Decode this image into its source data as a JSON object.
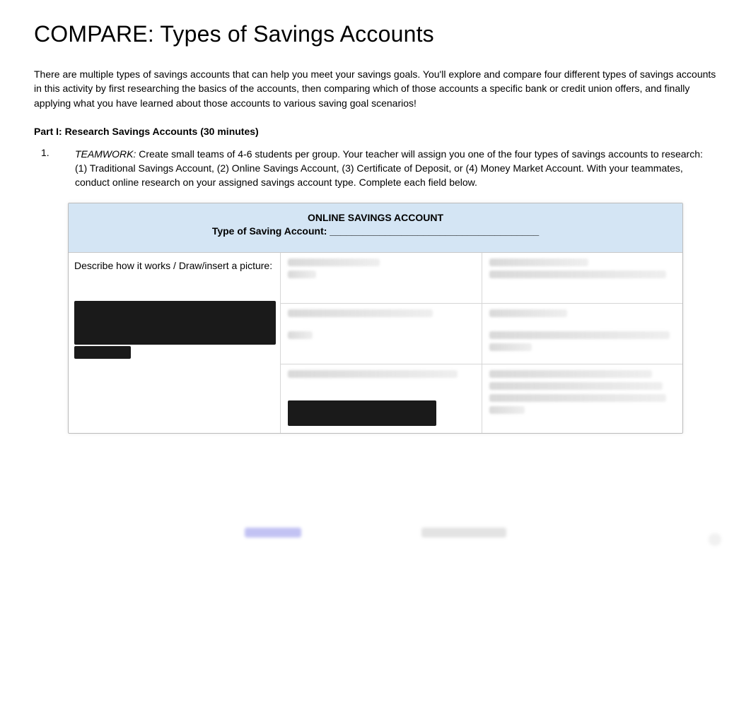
{
  "title": "COMPARE: Types of Savings Accounts",
  "intro": "There are multiple types of savings accounts that can help you meet your savings goals. You'll explore and compare four different types of savings accounts in this activity by first researching the basics of the accounts, then comparing which of those accounts a specific bank or credit union offers, and finally applying what you have learned about those accounts to various saving goal scenarios!",
  "part_heading": "Part I: Research Savings Accounts (30 minutes)",
  "list": {
    "num": "1.",
    "teamwork_label": "TEAMWORK:",
    "text": " Create small teams of 4-6 students per group. Your teacher will assign you one of the four types of savings accounts to research: (1) Traditional Savings Account, (2) Online Savings Account, (3) Certificate of Deposit, or (4) Money Market Account. With your teammates, conduct online research on your assigned savings account type. Complete each field below."
  },
  "table": {
    "header_line1": "ONLINE SAVINGS ACCOUNT",
    "header_line2": "Type of Saving Account: ______________________________________",
    "describe_label": "Describe how it works / Draw/insert a picture:"
  }
}
